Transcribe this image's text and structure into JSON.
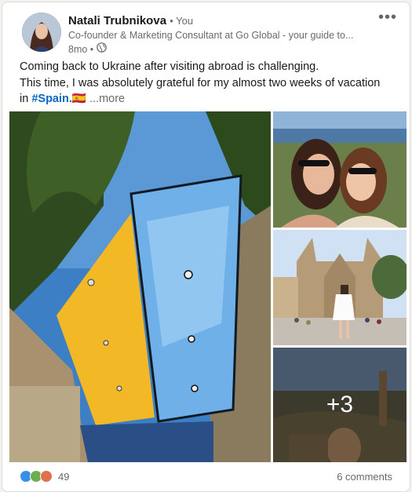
{
  "author": {
    "name": "Natali Trubnikova",
    "relation": "• You",
    "headline": "Co-founder & Marketing Consultant at Go Global - your guide to...",
    "time": "8mo •",
    "visibility_icon": "globe-icon"
  },
  "post": {
    "line1": "Coming back to Ukraine after visiting abroad is challenging.",
    "line2": "This time, I was absolutely grateful for my almost two weeks of vacation",
    "line3_prefix": "in ",
    "hashtag": "#Spain.",
    "flag": "🇪🇸",
    "see_more": "...more"
  },
  "media": {
    "extra_count": "+3"
  },
  "social": {
    "reaction_icons": [
      "like-icon",
      "celebrate-icon",
      "love-icon"
    ],
    "reaction_count": "49",
    "comments": "6 comments"
  },
  "colors": {
    "link": "#0a66c2",
    "sky": "#3d7fc4",
    "yellow": "#f2b825"
  }
}
